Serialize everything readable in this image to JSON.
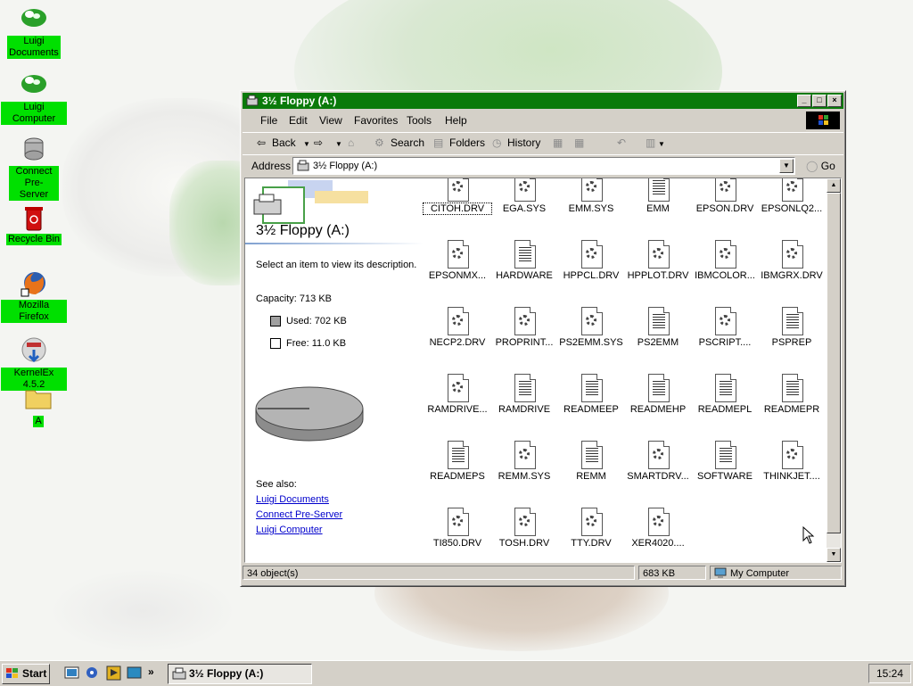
{
  "desktop": {
    "icons": [
      {
        "label": "Luigi Documents",
        "icon": "cloud-icon"
      },
      {
        "label": "Luigi Computer",
        "icon": "cloud-icon"
      },
      {
        "label": "Connect Pre-Server",
        "icon": "server-icon"
      },
      {
        "label": "Recycle Bin",
        "icon": "recycle-bin-icon"
      },
      {
        "label": "Mozilla Firefox",
        "icon": "firefox-icon"
      },
      {
        "label": "KernelEx 4.5.2",
        "icon": "installer-icon"
      },
      {
        "label": "A",
        "icon": "folder-icon"
      }
    ]
  },
  "window": {
    "title": "3½ Floppy (A:)",
    "menu": [
      "File",
      "Edit",
      "View",
      "Favorites",
      "Tools",
      "Help"
    ],
    "toolbar": {
      "back": "Back",
      "search": "Search",
      "folders": "Folders",
      "history": "History"
    },
    "address": {
      "label": "Address",
      "value": "3½ Floppy (A:)",
      "go": "Go"
    },
    "left_pane": {
      "title": "3½ Floppy (A:)",
      "hint": "Select an item to view its description.",
      "capacity": "Capacity: 713 KB",
      "used": "Used: 702 KB",
      "free": "Free: 11.0 KB",
      "see_also": "See also:",
      "links": [
        "Luigi Documents",
        "Connect Pre-Server",
        "Luigi Computer"
      ]
    },
    "files": [
      {
        "name": "CITOH.DRV",
        "type": "gear"
      },
      {
        "name": "EGA.SYS",
        "type": "gear"
      },
      {
        "name": "EMM.SYS",
        "type": "gear"
      },
      {
        "name": "EMM",
        "type": "text"
      },
      {
        "name": "EPSON.DRV",
        "type": "gear"
      },
      {
        "name": "EPSONLQ2...",
        "type": "gear"
      },
      {
        "name": "EPSONMX...",
        "type": "gear"
      },
      {
        "name": "HARDWARE",
        "type": "text"
      },
      {
        "name": "HPPCL.DRV",
        "type": "gear"
      },
      {
        "name": "HPPLOT.DRV",
        "type": "gear"
      },
      {
        "name": "IBMCOLOR...",
        "type": "gear"
      },
      {
        "name": "IBMGRX.DRV",
        "type": "gear"
      },
      {
        "name": "NECP2.DRV",
        "type": "gear"
      },
      {
        "name": "PROPRINT...",
        "type": "gear"
      },
      {
        "name": "PS2EMM.SYS",
        "type": "gear"
      },
      {
        "name": "PS2EMM",
        "type": "text"
      },
      {
        "name": "PSCRIPT....",
        "type": "gear"
      },
      {
        "name": "PSPREP",
        "type": "text"
      },
      {
        "name": "RAMDRIVE...",
        "type": "gear"
      },
      {
        "name": "RAMDRIVE",
        "type": "text"
      },
      {
        "name": "READMEEP",
        "type": "text"
      },
      {
        "name": "READMEHP",
        "type": "text"
      },
      {
        "name": "READMEPL",
        "type": "text"
      },
      {
        "name": "READMEPR",
        "type": "text"
      },
      {
        "name": "READMEPS",
        "type": "text"
      },
      {
        "name": "REMM.SYS",
        "type": "gear"
      },
      {
        "name": "REMM",
        "type": "text"
      },
      {
        "name": "SMARTDRV...",
        "type": "gear"
      },
      {
        "name": "SOFTWARE",
        "type": "text"
      },
      {
        "name": "THINKJET....",
        "type": "gear"
      },
      {
        "name": "TI850.DRV",
        "type": "gear"
      },
      {
        "name": "TOSH.DRV",
        "type": "gear"
      },
      {
        "name": "TTY.DRV",
        "type": "gear"
      },
      {
        "name": "XER4020....",
        "type": "gear"
      }
    ],
    "status": {
      "objects": "34 object(s)",
      "size": "683 KB",
      "zone": "My Computer"
    }
  },
  "taskbar": {
    "start": "Start",
    "task": "3½ Floppy (A:)",
    "clock": "15:24"
  },
  "colors": {
    "titlebar": "#0a7a0a",
    "desktop_label_bg": "#00e000",
    "link": "#0000cc"
  }
}
